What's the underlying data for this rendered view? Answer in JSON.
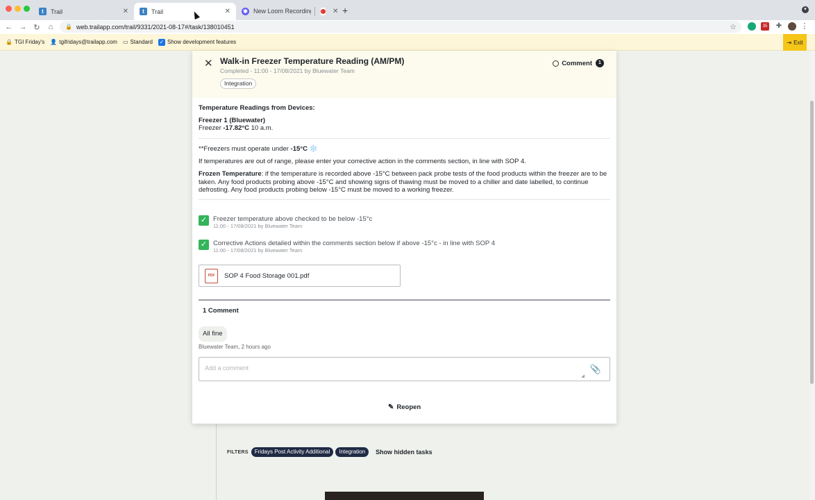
{
  "browser": {
    "tabs": [
      {
        "label": "Trail",
        "favicon": "trail-favicon",
        "active": false
      },
      {
        "label": "Trail",
        "favicon": "trail-favicon",
        "active": true
      },
      {
        "label": "New Loom Recording 🎥",
        "favicon": "loom-favicon",
        "active": false
      },
      {
        "label": "",
        "favicon": "record-icon",
        "active": false
      }
    ],
    "url": "web.trailapp.com/trail/9331/2021-08-17#/task/138010451",
    "ext_badge": "35"
  },
  "bookmarks": {
    "site": "TGI Friday's",
    "user": "tgifridays@trailapp.com",
    "plan": "Standard",
    "dev_features": "Show development features",
    "exit": "Exit"
  },
  "task": {
    "title": "Walk-in Freezer Temperature Reading (AM/PM)",
    "meta": "Completed - 11:00 - 17/08/2021 by Bluewater Team",
    "tag": "Integration",
    "comment_label": "Comment",
    "comment_count": "1"
  },
  "readings": {
    "heading": "Temperature Readings from Devices:",
    "device_name": "Freezer 1 (Bluewater)",
    "device_prefix": "Freezer",
    "device_value": "-17.82°C",
    "device_time": "10 a.m."
  },
  "instructions": {
    "rule_prefix": "**Freezers must operate under",
    "rule_value": "-15°C",
    "rule_icon": "❄️",
    "corrective": "If temperatures are out of range, please enter your corrective action in the comments section, in line with SOP 4.",
    "frozen_label": "Frozen Temperature",
    "frozen_text": ": if the temperature is recorded above -15°C between pack probe tests of the food products within the freezer are to be taken. Any food products probing above -15°C and showing signs of thawing must be moved to a chiller and date labelled, to continue defrosting. Any food products probing below -15°C must be moved to a working freezer."
  },
  "checklist": [
    {
      "label": "Freezer temperature above checked to be below -15°c",
      "meta": "11:00 - 17/08/2021 by Bluewater Team",
      "checked": true
    },
    {
      "label": "Corrective Actions detailed within the comments section below if above -15°c - in line with SOP 4",
      "meta": "11:00 - 17/08/2021 by Bluewater Team",
      "checked": true
    }
  ],
  "attachment": {
    "filename": "SOP 4 Food Storage 001.pdf",
    "icon_text": "PDF"
  },
  "comments": {
    "count_label": "1 Comment",
    "items": [
      {
        "text": "All fine",
        "meta": "Bluewater Team, 2 hours ago"
      }
    ],
    "placeholder": "Add a comment"
  },
  "reopen_label": "Reopen",
  "filters": {
    "label": "FILTERS",
    "chips": [
      "Fridays Post Activity Additional",
      "Integration"
    ],
    "show_hidden": "Show hidden tasks"
  }
}
